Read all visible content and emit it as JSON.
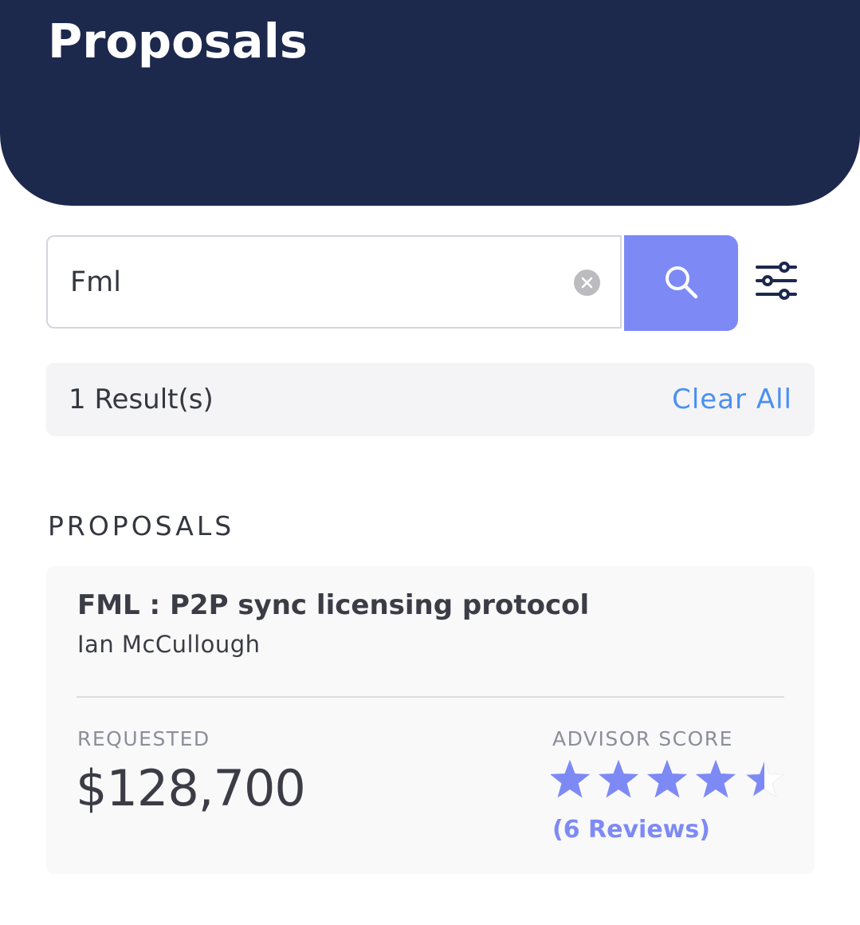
{
  "header": {
    "title": "Proposals"
  },
  "search": {
    "value": "Fml",
    "icon": "search-icon",
    "clear_icon": "clear-icon",
    "filter_icon": "filter-sliders-icon"
  },
  "results": {
    "count_text": "1 Result(s)",
    "clear_all_label": "Clear All"
  },
  "section": {
    "heading": "PROPOSALS"
  },
  "proposals": [
    {
      "title": "FML : P2P sync licensing protocol",
      "author": "Ian McCullough",
      "requested_label": "REQUESTED",
      "requested_amount": "$128,700",
      "score_label": "ADVISOR SCORE",
      "rating": 4.5,
      "rating_max": 5,
      "reviews_text": "(6 Reviews)"
    }
  ],
  "colors": {
    "header_bg": "#1d284d",
    "accent": "#7d8af5",
    "link": "#4a8ff2",
    "star_empty": "#ffffff"
  }
}
